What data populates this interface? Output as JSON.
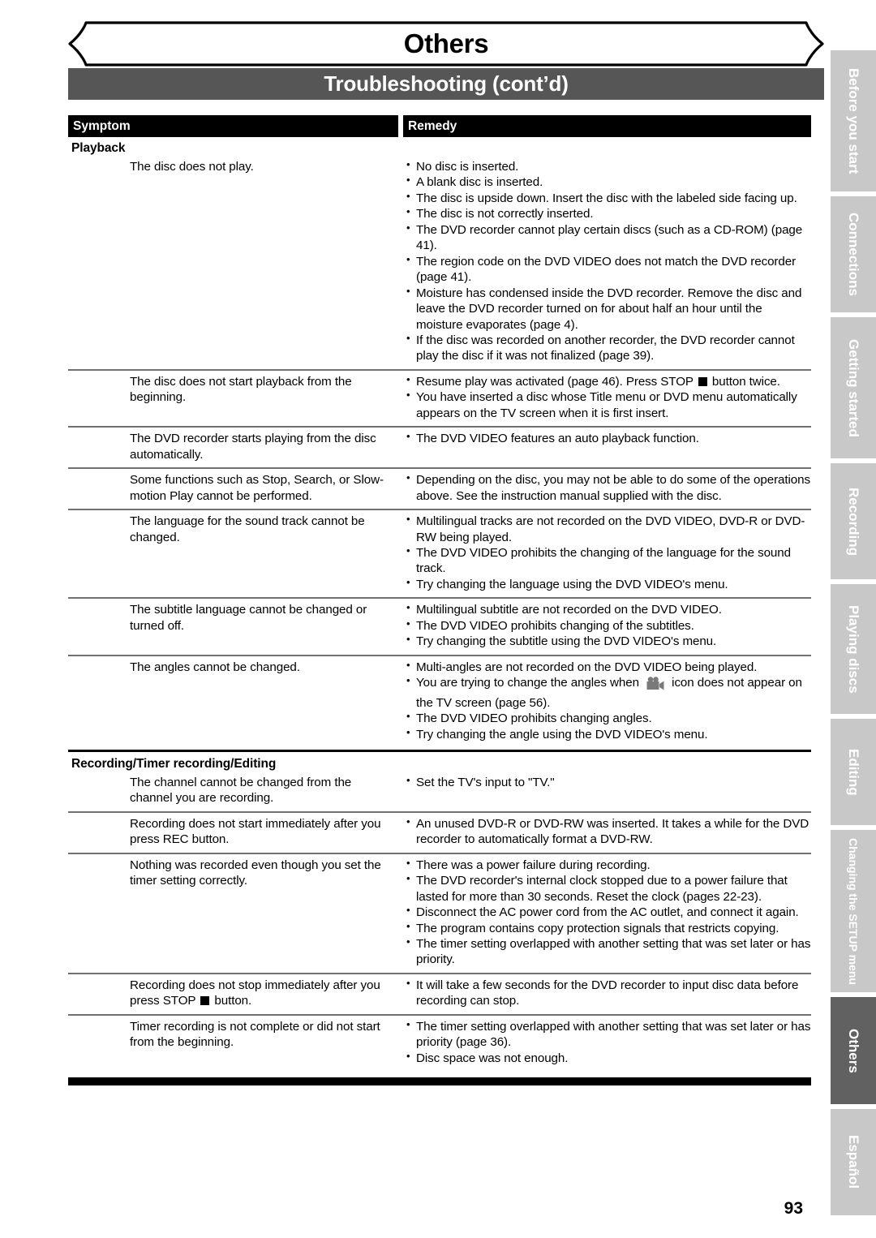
{
  "header": {
    "banner_title": "Others",
    "section_title": "Troubleshooting (cont’d)"
  },
  "table": {
    "columns": {
      "symptom": "Symptom",
      "remedy": "Remedy"
    },
    "groups": [
      {
        "title": "Playback",
        "rows": [
          {
            "symptom": "The disc does not play.",
            "remedies": [
              "No disc is inserted.",
              "A blank disc is inserted.",
              "The disc is upside down. Insert the disc with the labeled side facing up.",
              "The disc is not correctly inserted.",
              "The DVD recorder cannot play certain discs (such as a CD-ROM) (page 41).",
              "The region code on the DVD VIDEO does not match the DVD recorder (page 41).",
              "Moisture has condensed inside the DVD recorder. Remove the disc and leave the DVD recorder turned on for about half an hour until the moisture evaporates (page 4).",
              "If the disc was recorded on another recorder, the DVD recorder cannot play the disc if it was not finalized (page 39)."
            ]
          },
          {
            "symptom": "The disc does not start playback from the beginning.",
            "remedies": [
              "Resume play was activated (page 46). Press STOP ■ button twice.",
              "You have inserted a disc whose Title menu or DVD menu automatically appears on the TV screen when it is first insert."
            ]
          },
          {
            "symptom": "The DVD recorder starts playing from the disc automatically.",
            "remedies": [
              "The DVD VIDEO features an auto playback function."
            ]
          },
          {
            "symptom": "Some functions such as Stop, Search, or Slow-motion Play cannot be performed.",
            "remedies": [
              "Depending on the disc, you may not be able to do some of the operations above. See the instruction manual supplied with the disc."
            ]
          },
          {
            "symptom": "The language for the sound track cannot be changed.",
            "remedies": [
              "Multilingual tracks are not recorded on the DVD VIDEO, DVD-R or DVD-RW being played.",
              "The DVD VIDEO prohibits the changing of the language for the sound track.",
              "Try changing the language using the DVD VIDEO's menu."
            ]
          },
          {
            "symptom": "The subtitle language cannot be changed or turned off.",
            "remedies": [
              "Multilingual subtitle are not recorded on the DVD VIDEO.",
              "The DVD VIDEO prohibits changing of the subtitles.",
              "Try changing the subtitle using the DVD VIDEO's menu."
            ]
          },
          {
            "symptom": "The angles cannot be changed.",
            "remedies": [
              "Multi-angles are not recorded on the DVD VIDEO being played.",
              "You are trying to change the angles when   icon does not appear on the TV screen (page 56).",
              "The DVD VIDEO prohibits changing angles.",
              "Try changing the angle using the DVD VIDEO's menu."
            ]
          }
        ]
      },
      {
        "title": "Recording/Timer recording/Editing",
        "rows": [
          {
            "symptom": "The channel cannot be changed from the channel you are recording.",
            "remedies": [
              "Set the TV's input to \"TV.\""
            ]
          },
          {
            "symptom": "Recording does not start immediately after you press REC button.",
            "remedies": [
              "An unused DVD-R or DVD-RW was inserted. It takes a while for the DVD recorder to automatically format a DVD-RW."
            ]
          },
          {
            "symptom": "Nothing was recorded even though you set the timer setting correctly.",
            "remedies": [
              "There was a power failure during recording.",
              "The DVD recorder's internal clock stopped due to a power failure that lasted for more than 30 seconds. Reset the clock (pages 22-23).",
              "Disconnect the AC power cord from the AC outlet, and connect it again.",
              "The program contains copy protection signals that restricts copying.",
              "The timer setting overlapped with another setting that was set later or has priority."
            ]
          },
          {
            "symptom": "Recording does not stop immediately after you press STOP ■ button.",
            "remedies": [
              "It will take a few seconds for the DVD recorder to input disc data before recording can stop."
            ]
          },
          {
            "symptom": "Timer recording is not complete or did not start from the beginning.",
            "remedies": [
              "The timer setting overlapped with another setting that was set later or has priority (page 36).",
              "Disc space was not enough."
            ]
          }
        ]
      }
    ]
  },
  "sidebar": {
    "tabs": [
      {
        "label": "Before you start",
        "active": false
      },
      {
        "label": "Connections",
        "active": false
      },
      {
        "label": "Getting started",
        "active": false
      },
      {
        "label": "Recording",
        "active": false
      },
      {
        "label": "Playing discs",
        "active": false
      },
      {
        "label": "Editing",
        "active": false
      },
      {
        "label": "Changing the SETUP menu",
        "active": false
      },
      {
        "label": "Others",
        "active": true
      },
      {
        "label": "Español",
        "active": false
      }
    ]
  },
  "footer": {
    "page_number": "93"
  },
  "colors": {
    "section_bar": "#565656",
    "header_bar": "#000000",
    "tab_inactive": "#c8c8c8",
    "tab_active": "#616161",
    "rule": "#707070"
  }
}
